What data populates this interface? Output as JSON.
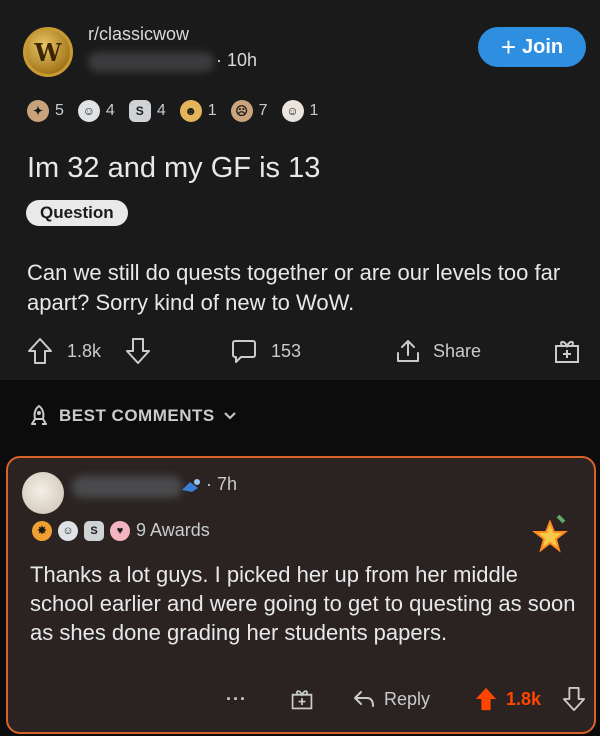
{
  "post": {
    "subreddit": "r/classicwow",
    "subreddit_icon_letter": "W",
    "time": "· 10h",
    "join_label": "Join",
    "awards": [
      {
        "icon": "rocket-like-award-icon",
        "count": "5",
        "color": "#c8a27a"
      },
      {
        "icon": "wholesome-award-icon",
        "count": "4",
        "color": "#dfe3e6"
      },
      {
        "icon": "silver-award-icon",
        "count": "4",
        "color": "#cfd3d6"
      },
      {
        "icon": "gold-face-award-icon",
        "count": "1",
        "color": "#e3b45a"
      },
      {
        "icon": "facepalm-award-icon",
        "count": "7",
        "color": "#caa57e"
      },
      {
        "icon": "flex-award-icon",
        "count": "1",
        "color": "#e9e4dc"
      }
    ],
    "title": "Im 32 and my GF is 13",
    "flair": "Question",
    "body": "Can we still do quests together or are our levels too far apart? Sorry kind of new to WoW.",
    "upvotes": "1.8k",
    "comments": "153",
    "share_label": "Share"
  },
  "sort": {
    "label": "BEST COMMENTS"
  },
  "comment": {
    "time": "· 7h",
    "awards_label": "9 Awards",
    "awards": [
      {
        "icon": "star-burst-award-icon",
        "color": "#f0a030"
      },
      {
        "icon": "wholesome-award-icon",
        "color": "#dfe3e6"
      },
      {
        "icon": "silver-award-icon",
        "color": "#cfd3d6"
      },
      {
        "icon": "heart-award-icon",
        "color": "#f3b4bf"
      }
    ],
    "body": "Thanks a lot guys. I picked her up from her middle school earlier and were going to get to questing as soon as shes done grading her students papers.",
    "more_label": "···",
    "reply_label": "Reply",
    "upvotes": "1.8k"
  },
  "colors": {
    "join_blue": "#2e8fe0",
    "upvote_orange": "#ff4500",
    "comment_border": "#d8622a"
  }
}
